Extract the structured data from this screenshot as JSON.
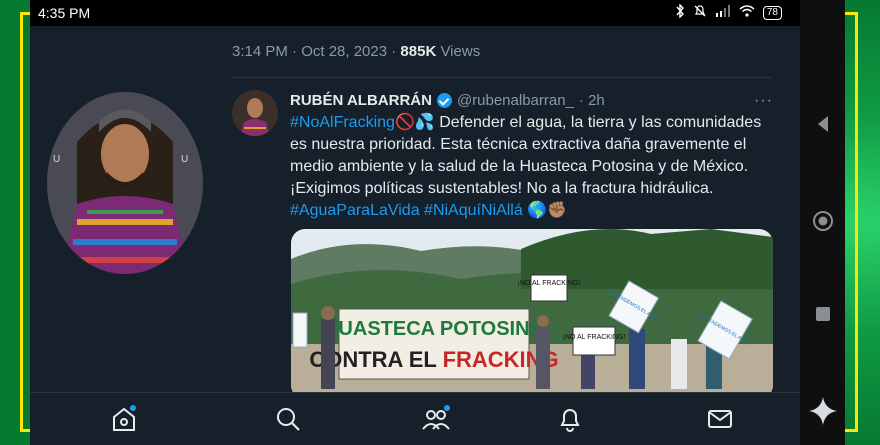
{
  "status": {
    "time": "4:35 PM",
    "battery": "78"
  },
  "post_meta": {
    "time": "3:14 PM · Oct 28, 2023 · ",
    "views_count": "885K",
    "views_label": " Views"
  },
  "tweet": {
    "display_name": "RUBÉN ALBARRÁN",
    "handle": "@rubenalbarran_",
    "age": "· 2h",
    "more": "···",
    "hashtag_first": "#NoAlFracking",
    "line1_emoji": "🚫💦",
    "line1_text": " Defender el agua, la tierra y las comunidades",
    "line2": "es nuestra prioridad. Esta técnica extractiva daña gravemente el",
    "line3": "medio ambiente y la salud de la Huasteca Potosina y de México.",
    "line4": "¡Exigimos políticas sustentables! No a la fractura hidráulica.",
    "hashtags_end": "#AguaParaLaVida #NiAquíNiAllá",
    "end_emoji": "🌎✊🏽"
  },
  "media": {
    "banner_line1": "HUASTECA POTOSINA",
    "banner_line2_a": "CONTRA EL ",
    "banner_line2_b": "FRACKING",
    "sign1": "¡NO AL FRACKING!",
    "sign2": "¡NO AL FRACKING!",
    "flag1": "DEFENDEMOS EL AGUA",
    "flag2": "DEFENDEMOS EL AGUA"
  },
  "nav": [
    "home-icon",
    "search-icon",
    "communities-icon",
    "notifications-icon",
    "messages-icon"
  ],
  "colors": {
    "accent": "#1d9bf0",
    "background": "#15202b",
    "frame": "#ffe600",
    "outer": "#0a8a3c"
  }
}
